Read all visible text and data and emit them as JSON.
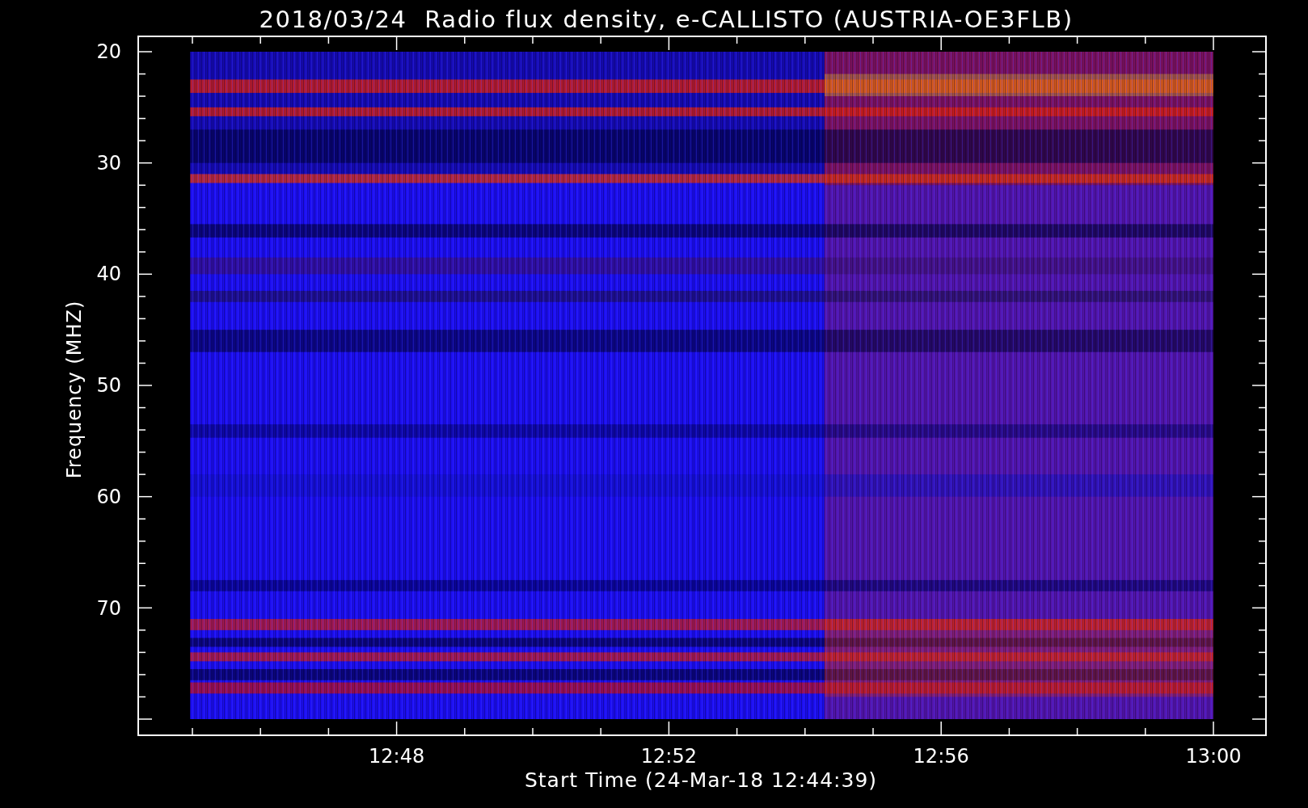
{
  "title": "2018/03/24  Radio flux density, e-CALLISTO (AUSTRIA-OE3FLB)",
  "y_axis": {
    "label": "Frequency (MHZ)",
    "ticks": [
      "20",
      "30",
      "40",
      "50",
      "60",
      "70"
    ]
  },
  "x_axis": {
    "label": "Start Time (24-Mar-18 12:44:39)",
    "ticks": [
      "12:48",
      "12:52",
      "12:56",
      "13:00"
    ]
  }
}
